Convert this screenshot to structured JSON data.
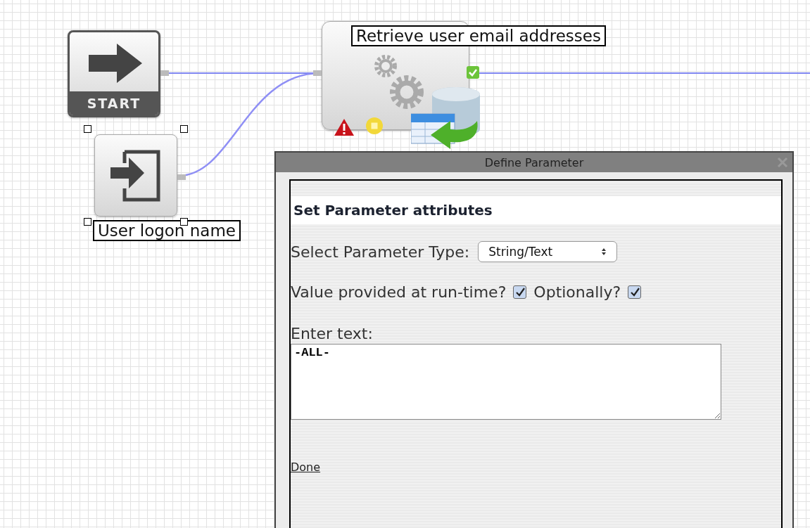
{
  "canvas": {
    "nodes": [
      {
        "kind": "start",
        "caption": "START"
      },
      {
        "kind": "input",
        "label": "User logon name",
        "selected": true
      },
      {
        "kind": "action",
        "label": "Retrieve user email addresses"
      }
    ]
  },
  "dialog": {
    "title": "Define Parameter",
    "heading": "Set Parameter attributes",
    "type_select": {
      "label": "Select Parameter Type:",
      "value": "String/Text"
    },
    "runtime": {
      "label": "Value provided at run-time?",
      "checked": true
    },
    "optional": {
      "label": "Optionally?",
      "checked": true
    },
    "text_field": {
      "label": "Enter text:",
      "value": "-ALL-"
    },
    "done": "Done"
  }
}
